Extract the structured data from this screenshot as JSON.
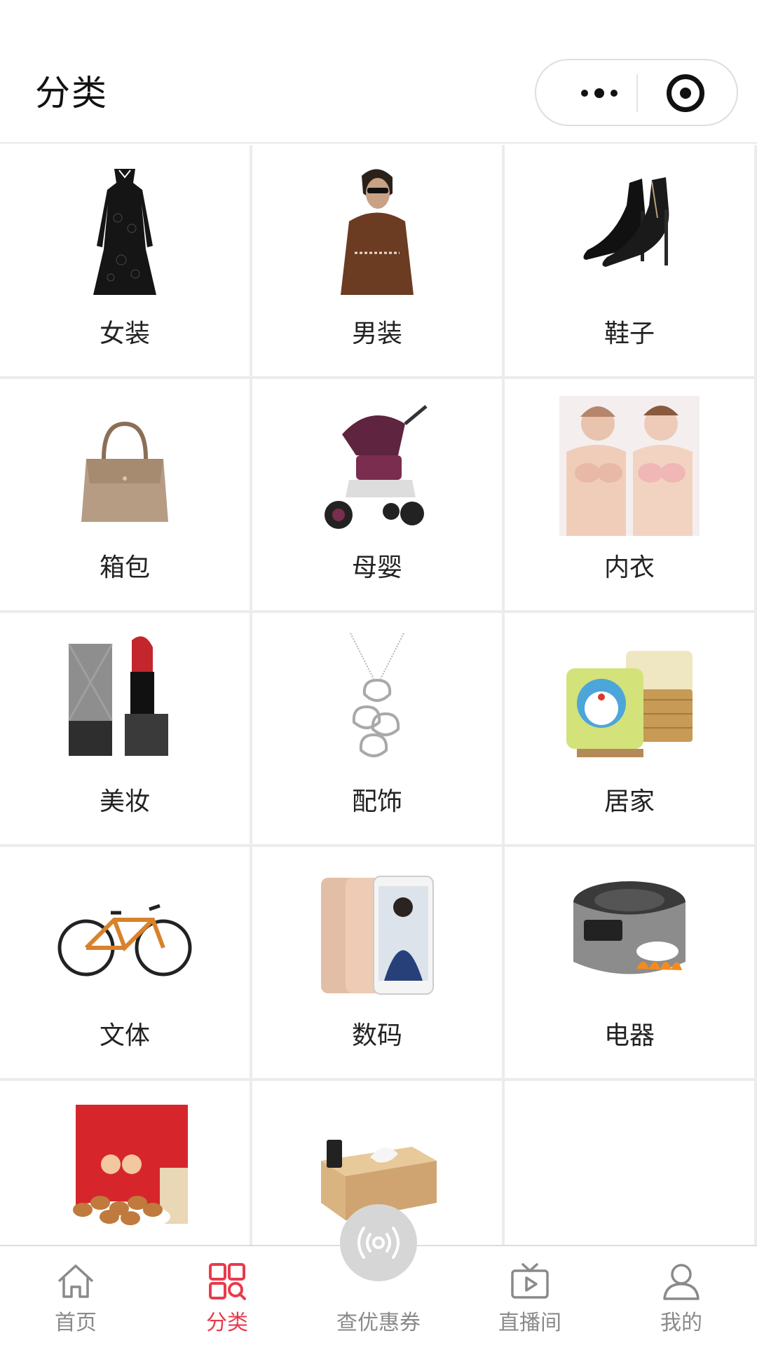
{
  "header": {
    "title": "分类"
  },
  "categories": [
    {
      "label": "女装",
      "icon": "dress-image"
    },
    {
      "label": "男装",
      "icon": "menswear-image"
    },
    {
      "label": "鞋子",
      "icon": "high-heels-image"
    },
    {
      "label": "箱包",
      "icon": "handbag-image"
    },
    {
      "label": "母婴",
      "icon": "stroller-image"
    },
    {
      "label": "内衣",
      "icon": "lingerie-image"
    },
    {
      "label": "美妆",
      "icon": "lipstick-image"
    },
    {
      "label": "配饰",
      "icon": "necklace-image"
    },
    {
      "label": "居家",
      "icon": "pillow-image"
    },
    {
      "label": "文体",
      "icon": "bicycle-image"
    },
    {
      "label": "数码",
      "icon": "smartphone-image"
    },
    {
      "label": "电器",
      "icon": "rice-cooker-image"
    },
    {
      "label": "",
      "icon": "nuts-gift-box-image"
    },
    {
      "label": "",
      "icon": "tissue-box-image"
    },
    {
      "label": "",
      "icon": ""
    }
  ],
  "tabbar": {
    "items": [
      {
        "label": "首页",
        "icon": "home-icon"
      },
      {
        "label": "分类",
        "icon": "category-icon"
      },
      {
        "label": "查优惠券",
        "icon": "broadcast-icon"
      },
      {
        "label": "直播间",
        "icon": "tv-icon"
      },
      {
        "label": "我的",
        "icon": "user-icon"
      }
    ],
    "active_color": "#e83b4c",
    "inactive_color": "#8a8a8a"
  }
}
